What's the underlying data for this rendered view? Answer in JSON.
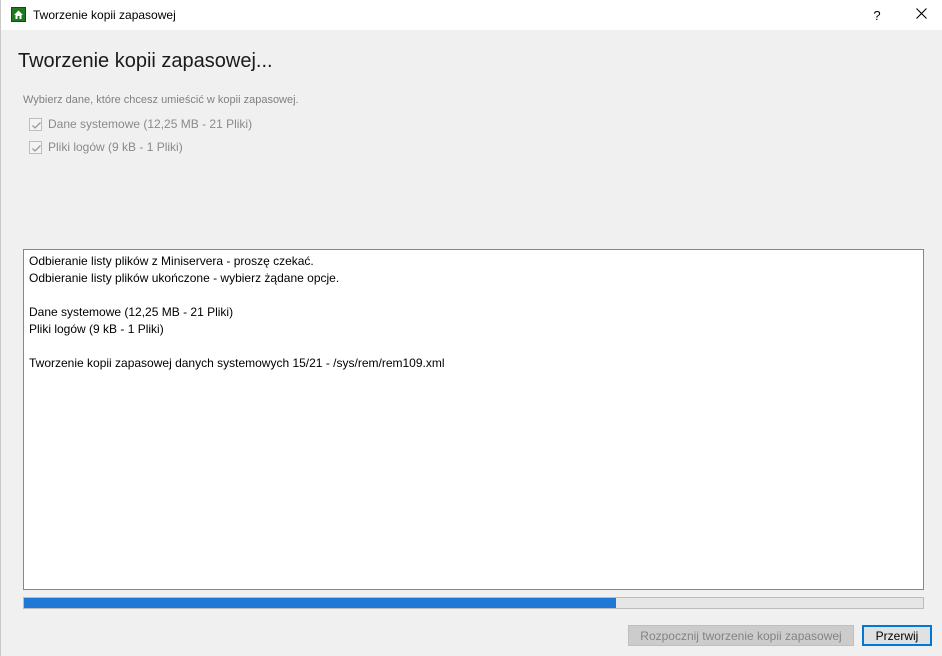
{
  "window": {
    "title": "Tworzenie kopii zapasowej",
    "help_label": "?",
    "app_icon": "house-icon",
    "close_icon": "close-icon"
  },
  "heading": "Tworzenie kopii zapasowej...",
  "instruction": "Wybierz dane, które chcesz umieścić w kopii zapasowej.",
  "options": [
    {
      "label": "Dane systemowe (12,25 MB - 21 Pliki)",
      "checked": true,
      "disabled": true
    },
    {
      "label": "Pliki logów (9 kB - 1 Pliki)",
      "checked": true,
      "disabled": true
    }
  ],
  "log": {
    "lines": [
      "Odbieranie listy plików z Miniservera - proszę czekać.",
      "Odbieranie listy plików ukończone - wybierz żądane opcje.",
      "",
      "Dane systemowe (12,25 MB - 21 Pliki)",
      "Pliki logów (9 kB - 1 Pliki)",
      "",
      "Tworzenie kopii zapasowej danych systemowych 15/21 - /sys/rem/rem109.xml"
    ]
  },
  "progress": {
    "fraction": 0.659
  },
  "buttons": {
    "start_label": "Rozpocznij tworzenie kopii zapasowej",
    "cancel_label": "Przerwij"
  },
  "colors": {
    "accent": "#0078d7",
    "progress": "#1f78d6"
  }
}
